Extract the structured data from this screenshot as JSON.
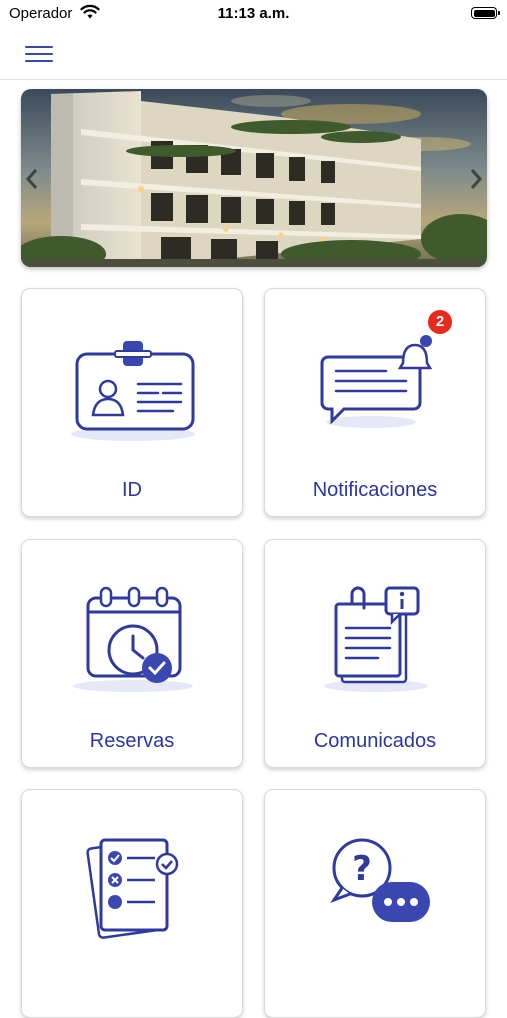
{
  "status_bar": {
    "carrier": "Operador",
    "time": "11:13 a.m."
  },
  "navbar": {
    "menu_icon": "hamburger-menu-icon"
  },
  "banner": {
    "image": "building-exterior-photo",
    "prev_icon": "chevron-left-icon",
    "next_icon": "chevron-right-icon"
  },
  "tiles": [
    {
      "label": "ID",
      "icon": "id-card-icon"
    },
    {
      "label": "Notificaciones",
      "icon": "notification-chat-bell-icon",
      "badge": "2"
    },
    {
      "label": "Reservas",
      "icon": "calendar-clock-check-icon"
    },
    {
      "label": "Comunicados",
      "icon": "clipboard-info-icon"
    },
    {
      "label": "",
      "icon": "checklist-icon"
    },
    {
      "label": "",
      "icon": "help-chat-icon"
    }
  ],
  "colors": {
    "accent": "#3a47b0",
    "label": "#2b36a3",
    "badge": "#e8291c",
    "shadow_ellipse": "#e6e8f7"
  }
}
